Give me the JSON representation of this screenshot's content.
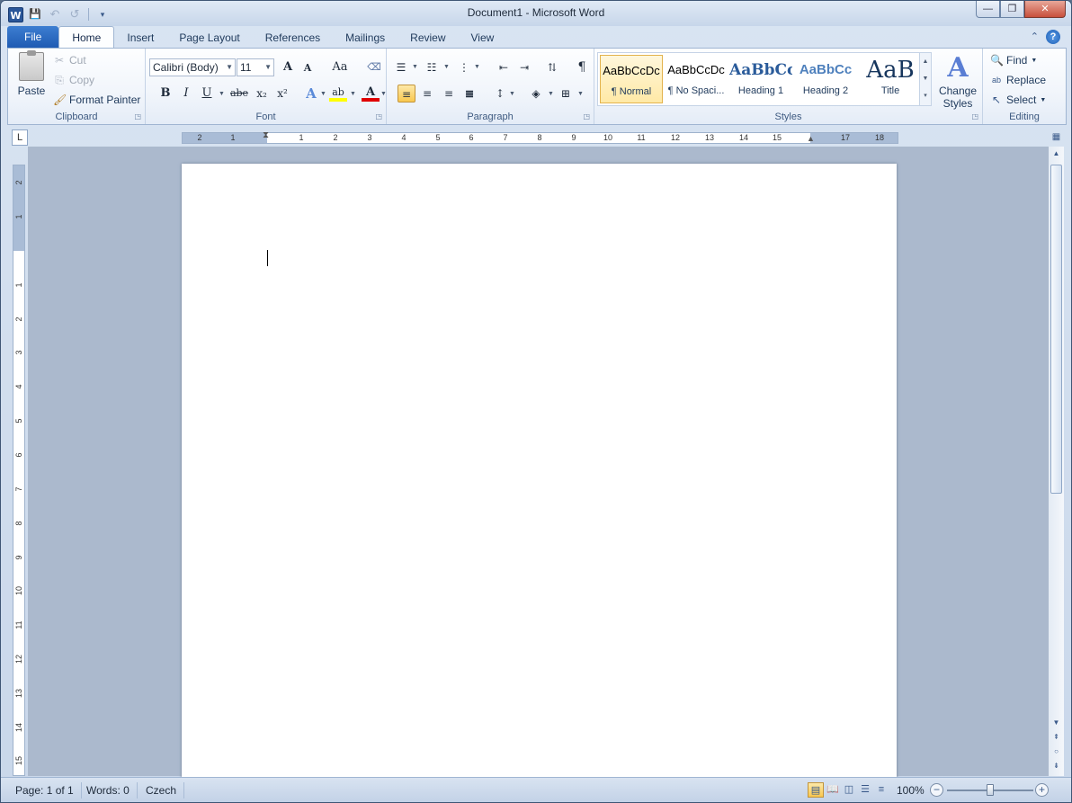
{
  "window": {
    "title": "Document1  -  Microsoft Word",
    "logo_letter": "W",
    "minimize": "—",
    "maximize": "❐",
    "close": "✕"
  },
  "quick_access": {
    "save": "💾",
    "undo": "↶",
    "redo": "↺",
    "customize": "▾"
  },
  "tabs": [
    {
      "label": "File"
    },
    {
      "label": "Home"
    },
    {
      "label": "Insert"
    },
    {
      "label": "Page Layout"
    },
    {
      "label": "References"
    },
    {
      "label": "Mailings"
    },
    {
      "label": "Review"
    },
    {
      "label": "View"
    }
  ],
  "ribbon_controls": {
    "collapse": "⌃",
    "help": "?"
  },
  "clipboard": {
    "group_label": "Clipboard",
    "paste": "Paste",
    "cut": "Cut",
    "copy": "Copy",
    "format_painter": "Format Painter"
  },
  "font": {
    "group_label": "Font",
    "family": "Calibri (Body)",
    "size": "11",
    "grow": "A",
    "shrink": "A",
    "change_case": "Aa",
    "clear": "⌫",
    "bold": "B",
    "italic": "I",
    "underline": "U",
    "strike": "abe",
    "subscript": "x₂",
    "superscript": "x²",
    "text_effects": "A",
    "highlight": "ab",
    "font_color": "A"
  },
  "paragraph": {
    "group_label": "Paragraph",
    "show_marks": "¶"
  },
  "styles": {
    "group_label": "Styles",
    "items": [
      {
        "preview": "AaBbCcDc",
        "name": "¶ Normal"
      },
      {
        "preview": "AaBbCcDc",
        "name": "¶ No Spaci..."
      },
      {
        "preview": "AaBbCc",
        "name": "Heading 1"
      },
      {
        "preview": "AaBbCc",
        "name": "Heading 2"
      },
      {
        "preview": "AaB",
        "name": "Title"
      }
    ],
    "change_styles_line1": "Change",
    "change_styles_line2": "Styles",
    "change_styles_icon": "A"
  },
  "editing": {
    "group_label": "Editing",
    "find": "Find",
    "replace": "Replace",
    "select": "Select"
  },
  "ruler": {
    "corner": "L",
    "h_numbers": [
      "2",
      "1",
      "1",
      "2",
      "3",
      "4",
      "5",
      "6",
      "7",
      "8",
      "9",
      "10",
      "11",
      "12",
      "13",
      "14",
      "15",
      "17",
      "18"
    ],
    "v_numbers": [
      "2",
      "1",
      "1",
      "2",
      "3",
      "4",
      "5",
      "6",
      "7",
      "8",
      "9",
      "10",
      "11",
      "12",
      "13",
      "14",
      "15"
    ]
  },
  "status": {
    "page": "Page: 1 of 1",
    "words": "Words: 0",
    "language": "Czech",
    "zoom": "100%",
    "zoom_minus": "−",
    "zoom_plus": "+"
  },
  "colors": {
    "accent": "#2b579a",
    "highlight_yellow": "#ffff00",
    "font_red": "#e00000"
  }
}
